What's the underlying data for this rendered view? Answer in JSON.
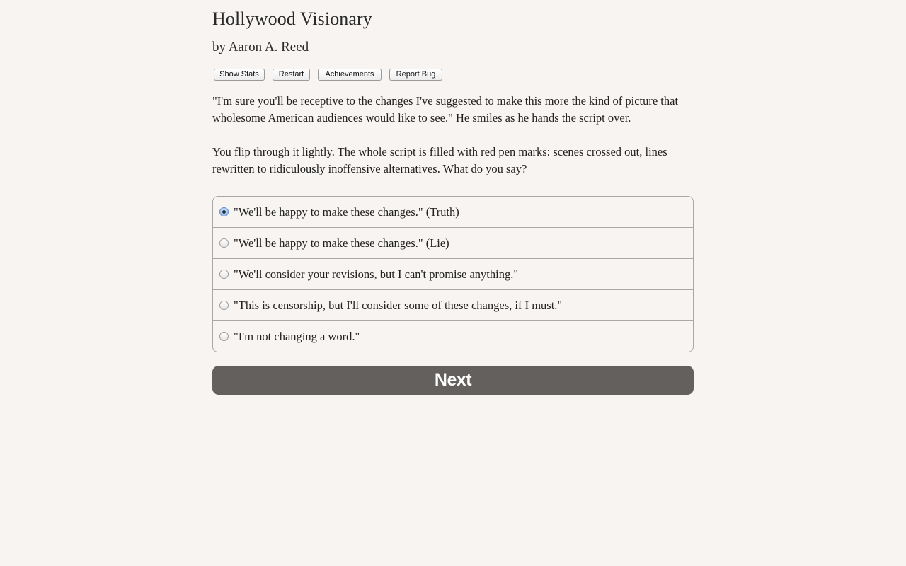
{
  "header": {
    "title": "Hollywood Visionary",
    "author": "by Aaron A. Reed"
  },
  "toolbar": {
    "show_stats_label": "Show Stats",
    "restart_label": "Restart",
    "achievements_label": "Achievements",
    "report_bug_label": "Report Bug"
  },
  "passage": {
    "paragraphs": [
      "\"I'm sure you'll be receptive to the changes I've suggested to make this more the kind of picture that wholesome American audiences would like to see.\" He smiles as he hands the script over.",
      "You flip through it lightly. The whole script is filled with red pen marks: scenes crossed out, lines rewritten to ridiculously inoffensive alternatives. What do you say?"
    ]
  },
  "choices": {
    "selected_index": 0,
    "items": [
      {
        "label": "\"We'll be happy to make these changes.\" (Truth)",
        "checked": true
      },
      {
        "label": "\"We'll be happy to make these changes.\" (Lie)",
        "checked": false
      },
      {
        "label": "\"We'll consider your revisions, but I can't promise anything.\"",
        "checked": false
      },
      {
        "label": "\"This is censorship, but I'll consider some of these changes, if I must.\"",
        "checked": false
      },
      {
        "label": "\"I'm not changing a word.\"",
        "checked": false
      }
    ]
  },
  "next_button": {
    "label": "Next"
  },
  "colors": {
    "background": "#f7f4f1",
    "next_button_bg": "#63605d",
    "radio_selected": "#5d8ac3"
  }
}
